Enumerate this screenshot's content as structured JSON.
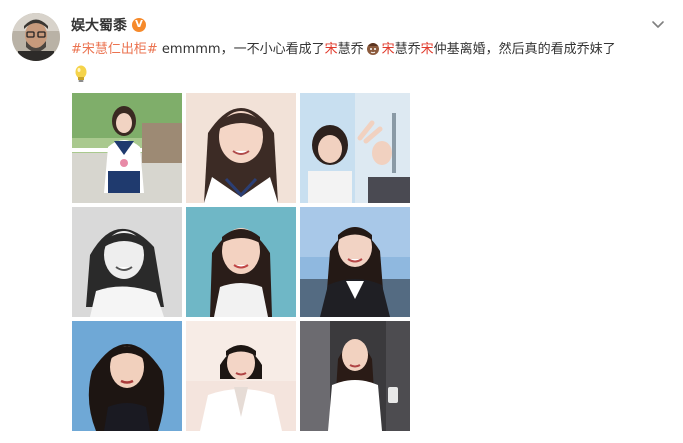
{
  "post": {
    "author": "娱大蜀黍",
    "verified_badge": "V",
    "text": {
      "hashtag": "#宋慧仁出柜#",
      "part1": " emmmm，一不小心看成了",
      "kw1": "宋",
      "part2": "慧乔",
      "kw2": "宋",
      "part3": "慧乔",
      "kw3": "宋",
      "part4": "仲基离婚，然后真的看成乔妹了"
    },
    "photos_count": 9
  },
  "colors": {
    "hashtag": "#eb7350",
    "keyword": "#e0392b",
    "verified": "#f68a2b"
  },
  "icons": {
    "expand": "chevron-down-icon",
    "inline_emoji": "face-emoji-icon",
    "trailing_emoji": "lightbulb-emoji-icon"
  }
}
